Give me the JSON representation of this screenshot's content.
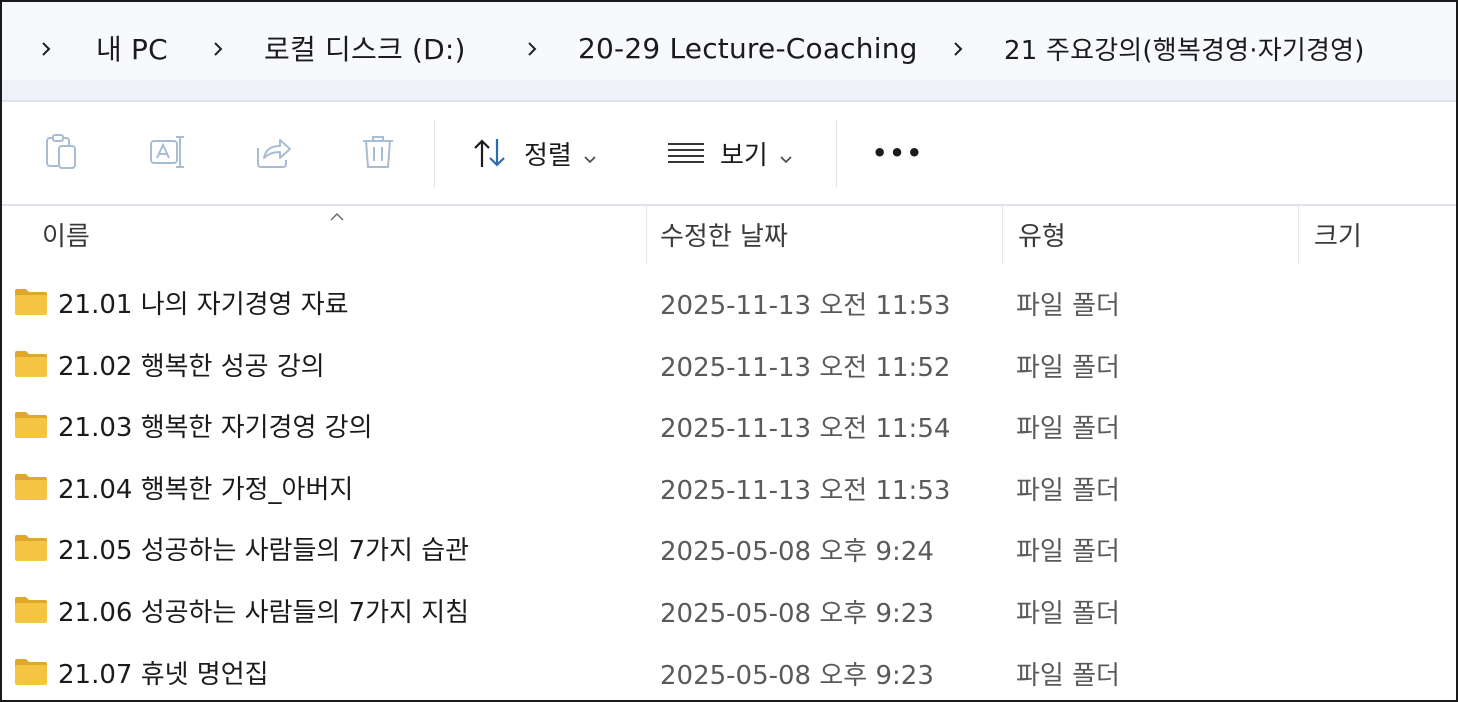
{
  "breadcrumb": {
    "items": [
      {
        "label": "내 PC"
      },
      {
        "label": "로컬 디스크 (D:)"
      },
      {
        "label": "20-29 Lecture-Coaching"
      },
      {
        "label": "21 주요강의(행복경영·자기경영)"
      }
    ]
  },
  "toolbar": {
    "copy_icon": "clipboard-icon",
    "rename_icon": "rename-icon",
    "share_icon": "share-icon",
    "delete_icon": "trash-icon",
    "sort_label": "정렬",
    "view_label": "보기",
    "more_label": "•••"
  },
  "columns": {
    "name": "이름",
    "date": "수정한 날짜",
    "type": "유형",
    "size": "크기"
  },
  "rows": [
    {
      "name": "21.01 나의 자기경영 자료",
      "date": "2025-11-13 오전 11:53",
      "type": "파일 폴더"
    },
    {
      "name": "21.02 행복한 성공 강의",
      "date": "2025-11-13 오전 11:52",
      "type": "파일 폴더"
    },
    {
      "name": "21.03 행복한 자기경영 강의",
      "date": "2025-11-13 오전 11:54",
      "type": "파일 폴더"
    },
    {
      "name": "21.04 행복한 가정_아버지",
      "date": "2025-11-13 오전 11:53",
      "type": "파일 폴더"
    },
    {
      "name": "21.05 성공하는 사람들의 7가지 습관",
      "date": "2025-05-08 오후 9:24",
      "type": "파일 폴더"
    },
    {
      "name": "21.06 성공하는 사람들의 7가지 지침",
      "date": "2025-05-08 오후 9:23",
      "type": "파일 폴더"
    },
    {
      "name": "21.07 휴넷 명언집",
      "date": "2025-05-08 오후 9:23",
      "type": "파일 폴더"
    }
  ],
  "colors": {
    "folder": "#f5c542",
    "folder_dark": "#e0a82a",
    "icon_disabled": "#a9bdd2",
    "accent": "#2b6cb0"
  }
}
